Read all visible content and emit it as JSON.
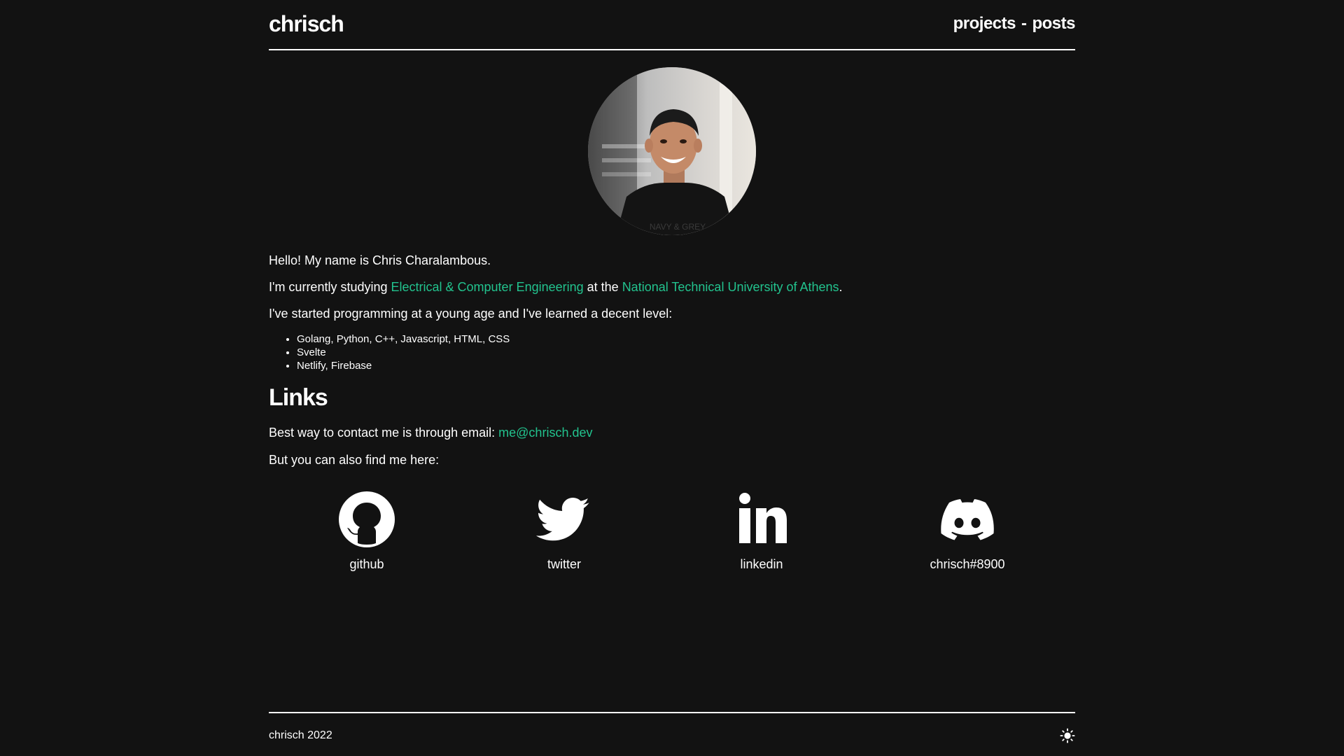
{
  "header": {
    "brand": "chrisch",
    "nav": {
      "projects": "projects",
      "separator": "-",
      "posts": "posts"
    }
  },
  "about": {
    "intro": "Hello! My name is Chris Charalambous.",
    "studying_prefix": "I'm currently studying ",
    "field_link": "Electrical & Computer Engineering",
    "studying_mid": " at the ",
    "university_link": "National Technical University of Athens",
    "studying_suffix": ".",
    "programming_text": "I've started programming at a young age and I've learned a decent level:",
    "skills": [
      "Golang, Python, C++, Javascript, HTML, CSS",
      "Svelte",
      "Netlify, Firebase"
    ]
  },
  "links": {
    "heading": "Links",
    "contact_prefix": "Best way to contact me is through email: ",
    "email": "me@chrisch.dev",
    "also_text": "But you can also find me here:",
    "social": [
      {
        "label": "github",
        "icon": "github-icon"
      },
      {
        "label": "twitter",
        "icon": "twitter-icon"
      },
      {
        "label": "linkedin",
        "icon": "linkedin-icon"
      },
      {
        "label": "chrisch#8900",
        "icon": "discord-icon"
      }
    ]
  },
  "footer": {
    "text": "chrisch 2022",
    "theme_icon": "sun-icon"
  },
  "colors": {
    "background": "#121212",
    "text": "#ffffff",
    "accent": "#22c38e"
  }
}
